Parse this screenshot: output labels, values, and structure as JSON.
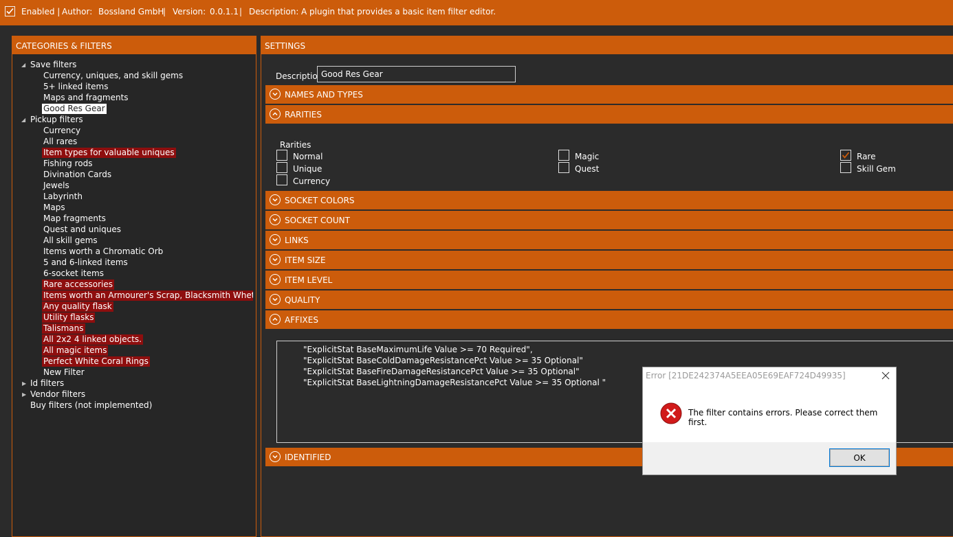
{
  "topbar": {
    "enabled_label": "Enabled |",
    "author_label": "Author:",
    "author_value": "Bossland GmbH",
    "sep1": "|",
    "version_label": "Version:",
    "version_value": "0.0.1.1",
    "sep2": "|",
    "description_label": "Description:",
    "description_value": "A plugin that provides a basic item filter editor.",
    "enabled_checked": true
  },
  "left": {
    "header": "CATEGORIES & FILTERS",
    "tree": [
      {
        "label": "Save filters",
        "level": 0,
        "toggle": "expanded"
      },
      {
        "label": "Currency, uniques, and skill gems",
        "level": 1
      },
      {
        "label": "5+ linked items",
        "level": 1
      },
      {
        "label": "Maps and fragments",
        "level": 1
      },
      {
        "label": "Good Res Gear",
        "level": 1,
        "state": "selected"
      },
      {
        "label": "Pickup filters",
        "level": 0,
        "toggle": "expanded"
      },
      {
        "label": "Currency",
        "level": 1
      },
      {
        "label": "All rares",
        "level": 1
      },
      {
        "label": "Item types for valuable uniques",
        "level": 1,
        "state": "error"
      },
      {
        "label": "Fishing rods",
        "level": 1
      },
      {
        "label": "Divination Cards",
        "level": 1
      },
      {
        "label": "Jewels",
        "level": 1
      },
      {
        "label": "Labyrinth",
        "level": 1
      },
      {
        "label": "Maps",
        "level": 1
      },
      {
        "label": "Map fragments",
        "level": 1
      },
      {
        "label": "Quest and uniques",
        "level": 1
      },
      {
        "label": "All skill gems",
        "level": 1
      },
      {
        "label": "Items worth a Chromatic Orb",
        "level": 1
      },
      {
        "label": "5 and 6-linked items",
        "level": 1
      },
      {
        "label": "6-socket items",
        "level": 1
      },
      {
        "label": "Rare accessories",
        "level": 1,
        "state": "error"
      },
      {
        "label": "Items worth an Armourer's Scrap, Blacksmith Whetstone, c",
        "level": 1,
        "state": "error"
      },
      {
        "label": "Any quality flask",
        "level": 1,
        "state": "error"
      },
      {
        "label": "Utility flasks",
        "level": 1,
        "state": "error"
      },
      {
        "label": "Talismans",
        "level": 1,
        "state": "error"
      },
      {
        "label": "All 2x2 4 linked objects.",
        "level": 1,
        "state": "error"
      },
      {
        "label": "All magic items",
        "level": 1,
        "state": "error"
      },
      {
        "label": "Perfect White Coral Rings",
        "level": 1,
        "state": "error"
      },
      {
        "label": "New Filter",
        "level": 1
      },
      {
        "label": "Id filters",
        "level": 0,
        "toggle": "collapsed"
      },
      {
        "label": "Vendor filters",
        "level": 0,
        "toggle": "collapsed"
      },
      {
        "label": "Buy filters (not implemented)",
        "level": 0
      }
    ]
  },
  "right": {
    "header": "SETTINGS",
    "description_label": "Description",
    "description_value": "Good Res Gear",
    "sections": {
      "names_types": "NAMES AND TYPES",
      "rarities": "RARITIES",
      "socket_colors": "SOCKET COLORS",
      "socket_count": "SOCKET COUNT",
      "links": "LINKS",
      "item_size": "ITEM SIZE",
      "item_level": "ITEM LEVEL",
      "quality": "QUALITY",
      "affixes": "AFFIXES",
      "identified": "IDENTIFIED"
    },
    "rarities": {
      "title": "Rarities",
      "normal": "Normal",
      "unique": "Unique",
      "currency": "Currency",
      "magic": "Magic",
      "quest": "Quest",
      "rare": "Rare",
      "skill_gem": "Skill Gem",
      "checked": [
        "Rare"
      ]
    },
    "affixes": [
      "\"ExplicitStat BaseMaximumLife Value >= 70 Required\",",
      "\"ExplicitStat BaseColdDamageResistancePct Value >= 35 Optional\"",
      "\"ExplicitStat BaseFireDamageResistancePct Value >= 35 Optional\"",
      "\"ExplicitStat BaseLightningDamageResistancePct Value >= 35 Optional \""
    ]
  },
  "dialog": {
    "title": "Error [21DE242374A5EEA05E69EAF724D49935]",
    "message": "The filter contains errors. Please correct them first.",
    "ok_label": "OK"
  },
  "colors": {
    "accent": "#cc5c0b",
    "background": "#2b2b2b",
    "error_highlight": "#8e0e0e",
    "error_icon": "#d11a1a"
  }
}
